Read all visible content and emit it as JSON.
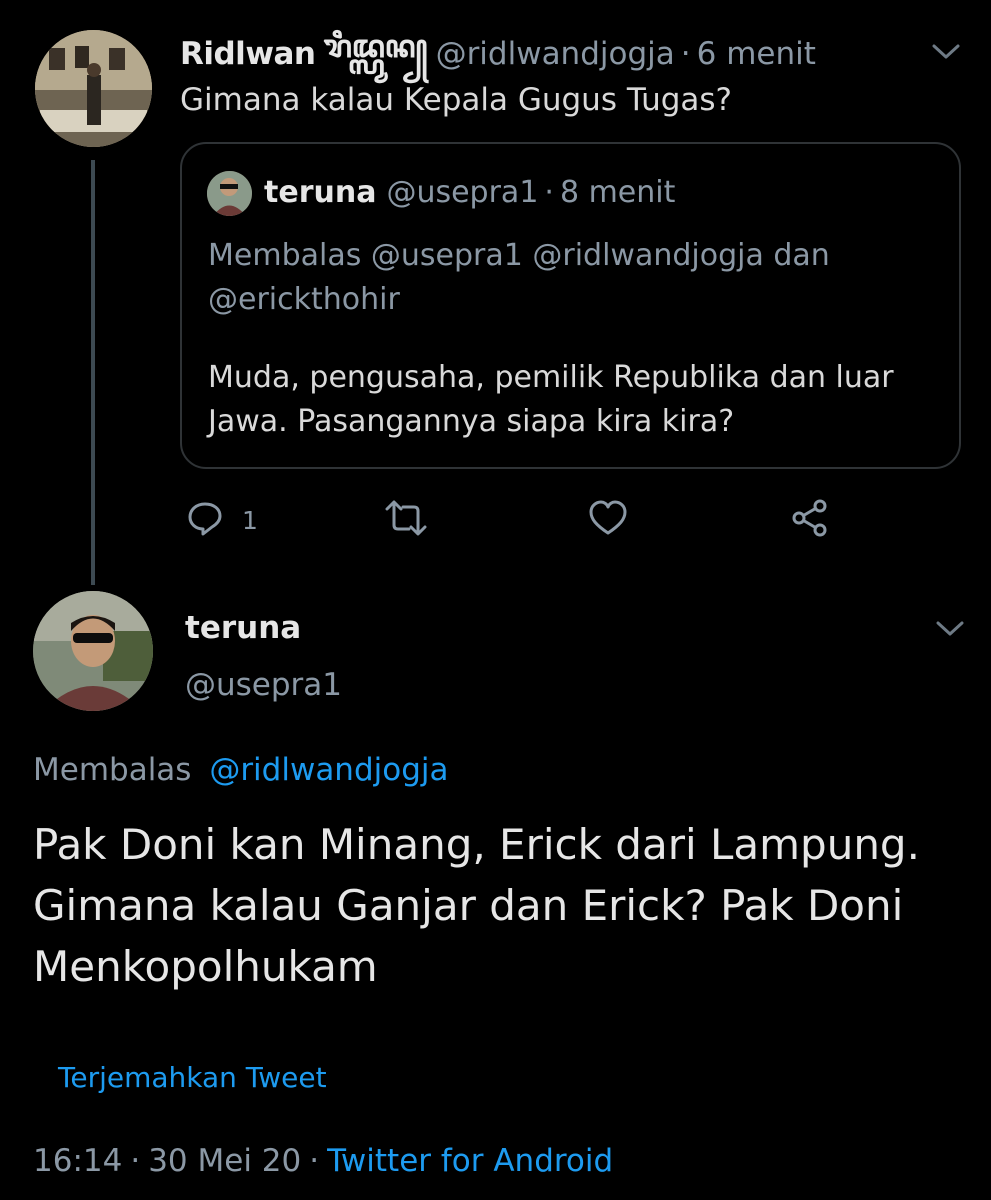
{
  "parent_tweet": {
    "display_name": "Ridlwan",
    "name_script": "ꦫꦶꦢ꧀ꦭ꧀ꦮꦤ꧀",
    "handle": "@ridlwandjogja",
    "separator": "·",
    "time_ago": "6 menit",
    "text": "Gimana kalau Kepala Gugus Tugas?",
    "quoted_tweet": {
      "display_name": "teruna",
      "handle": "@usepra1",
      "separator": "·",
      "time_ago": "8 menit",
      "reply_to": "Membalas @usepra1 @ridlwandjogja dan @erickthohir",
      "text": "Muda, pengusaha, pemilik Republika dan luar Jawa. Pasangannya siapa kira kira?"
    },
    "actions": {
      "reply_count": "1"
    }
  },
  "main_tweet": {
    "display_name": "teruna",
    "handle": "@usepra1",
    "reply_label": "Membalas",
    "reply_mention": "@ridlwandjogja",
    "text": "Pak Doni kan Minang, Erick dari Lampung. Gimana kalau Ganjar dan Erick? Pak Doni Menkopolhukam",
    "translate_label": "Terjemahkan Tweet",
    "time": "16:14",
    "separator": "·",
    "date": "30 Mei 20",
    "source": "Twitter for Android"
  },
  "colors": {
    "background": "#000000",
    "secondary_text": "#8b98a5",
    "link": "#1d9bf0",
    "border": "#2f3336"
  },
  "icons": [
    "chevron-down-icon",
    "reply-icon",
    "retweet-icon",
    "like-icon",
    "share-icon"
  ]
}
